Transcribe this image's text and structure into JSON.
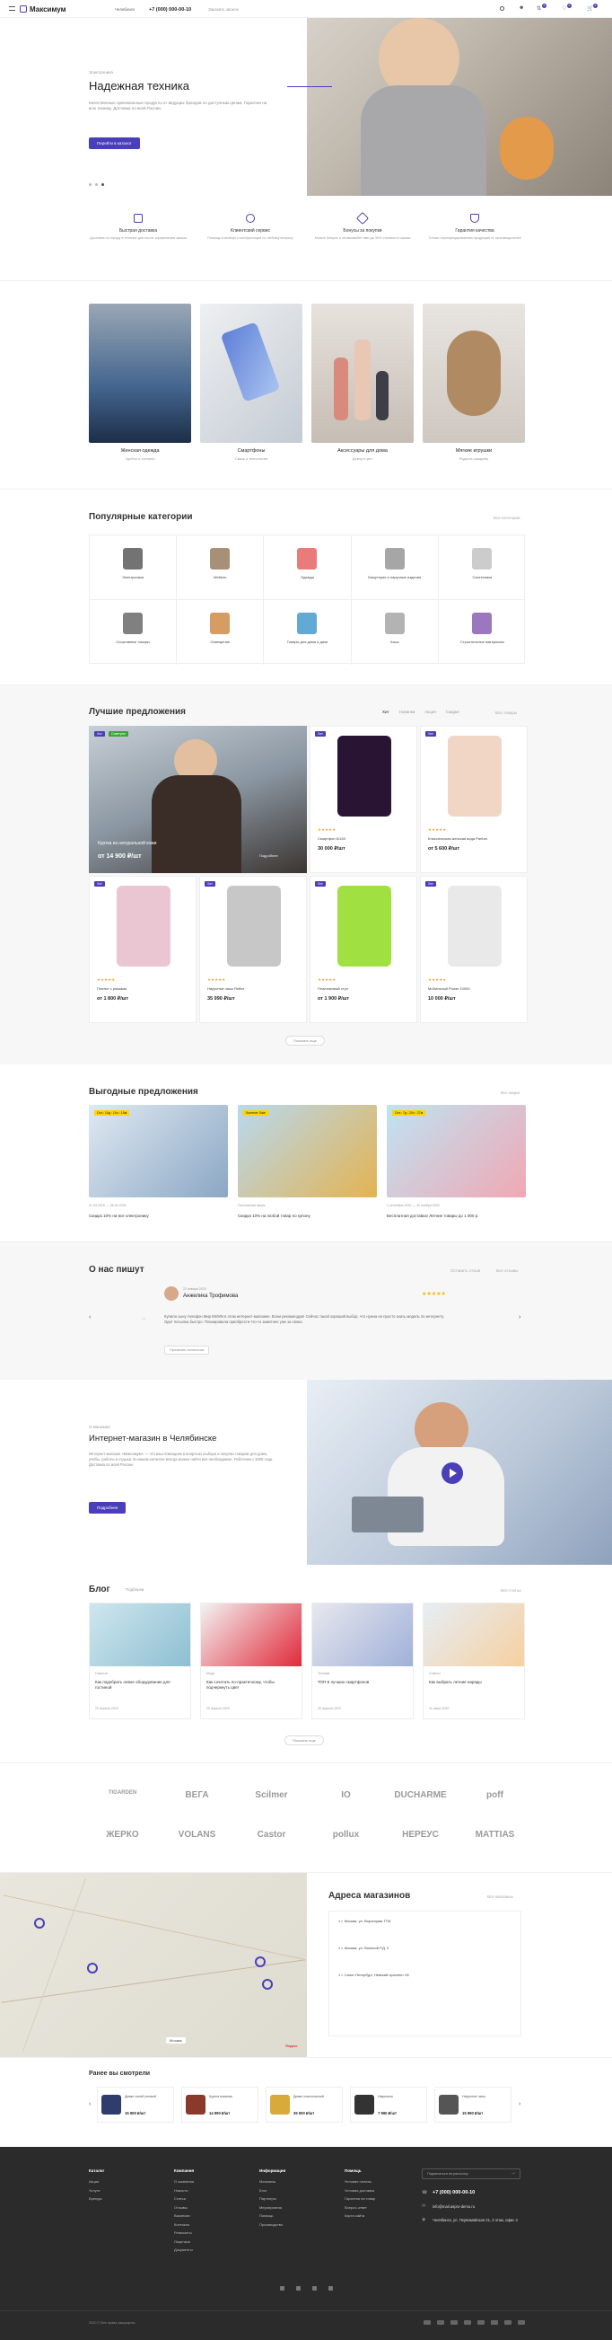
{
  "header": {
    "logo": "Максимум",
    "city": "Челябинск",
    "phone": "+7 (000) 000-00-10",
    "callback": "Заказать звонок",
    "cart_count": "0",
    "compare_count": "0",
    "favorites_count": "0"
  },
  "hero": {
    "tagline": "Электроника",
    "title": "Надежная техника",
    "text": "Качественные оригинальные продукты от ведущих брендов по доступным ценам. Гарантия на всю технику. Доставка по всей России.",
    "button": "Перейти в каталог"
  },
  "features": [
    {
      "icon": "bag-icon",
      "title": "Быстрая доставка",
      "text": "Доставка по городу в течение дня после оформления заказа"
    },
    {
      "icon": "crown-icon",
      "title": "Клиентский сервис",
      "text": "Помощь в выборе и консультации по любому вопросу"
    },
    {
      "icon": "percent-icon",
      "title": "Бонусы за покупки",
      "text": "Копите бонусы и оплачивайте ими до 30% стоимости заказа"
    },
    {
      "icon": "shield-icon",
      "title": "Гарантия качества",
      "text": "Только сертифицированная продукция от производителей"
    }
  ],
  "promo_cards": [
    {
      "title": "Женская одежда",
      "sub": "Удобно и стильно"
    },
    {
      "title": "Смартфоны",
      "sub": "Связь и технологии"
    },
    {
      "title": "Аксессуары для дома",
      "sub": "Декор и уют"
    },
    {
      "title": "Мягкие игрушки",
      "sub": "Радость каждому"
    }
  ],
  "popular": {
    "title": "Популярные категории",
    "all": "Все категории",
    "items": [
      "Электроника",
      "Мебель",
      "Одежда",
      "Бижутерия и наручные изделия",
      "Сантехника",
      "Спортивные товары",
      "Освещение",
      "Товары для дома и дачи",
      "Часы",
      "Строительные материалы"
    ]
  },
  "best": {
    "title": "Лучшие предложения",
    "tabs": [
      "Хит",
      "Новинки",
      "Акция",
      "Скидки"
    ],
    "all": "Все товары",
    "more": "Показать еще",
    "featured": {
      "title": "Куртка из натуральной кожи",
      "price": "от 14 900 ₽/шт",
      "note": "Подробнее"
    },
    "items": [
      {
        "name": "Смартфон 6/128",
        "price": "30 000 ₽/шт",
        "badge": "Хит"
      },
      {
        "name": "Классическая женская вода Parfum",
        "price": "от 5 600 ₽/шт",
        "badge": "Хит"
      },
      {
        "name": "Платье с рюшами",
        "price": "от 1 800 ₽/шт",
        "badge": "Хит"
      },
      {
        "name": "Наручные часы Reflex",
        "price": "35 990 ₽/шт",
        "badge": "Хит"
      },
      {
        "name": "Пластиковый стул",
        "price": "от 1 900 ₽/шт",
        "badge": "Хит"
      },
      {
        "name": "Мобильный Power 10000",
        "price": "10 000 ₽/шт",
        "badge": "Хит"
      }
    ]
  },
  "deals": {
    "title": "Выгодные предложения",
    "all": "Все акции",
    "items": [
      {
        "timer": "Ост.: 10д : 10ч : 15м",
        "date": "01.03.2020 — 26.04.2020",
        "text": "Скидка 10% на все электронику"
      },
      {
        "timer": "Summer Sale",
        "date": "Постоянная акция",
        "text": "Скидка 10% на любой товар по купону"
      },
      {
        "timer": "Ост.: 7д : 20ч : 37м",
        "date": "1 сентября 2020 — 30 ноября 2020",
        "text": "Бесплатная доставка! Летние товары до 1 000 р."
      }
    ]
  },
  "reviews": {
    "title": "О нас пишут",
    "all": "Все отзывы",
    "add": "Оставить отзыв",
    "author": "Анжелика Трофимова",
    "date": "22 января 2020",
    "text": "Купила сыну телефон Мир 8S/MN в этом интернет-магазине. Всем рекомендую! Сейчас такой хороший выбор, что нужна не просто знать модель по интернету. Одет посылка быстро. Планировала приобрести что-то заметнее уже за своих.",
    "more": "Прочитать полностью"
  },
  "about": {
    "tagline": "О магазине",
    "title": "Интернет-магазин в Челябинске",
    "text": "Интернет-магазин «Максимум» — это ваш помощник в вопросах выбора и покупки товаров для дома, учебы, работы и отдыха. В нашем каталоге всегда можно найти всё необходимое. Работаем с 2005 года. Доставка по всей России.",
    "button": "Подробнее"
  },
  "blog": {
    "title": "Блог",
    "filter": "Подборки",
    "all": "Все статьи",
    "more": "Показать еще",
    "items": [
      {
        "tag": "Новости",
        "title": "Как подобрать новое оборудование для гостиной",
        "date": "20 апреля 2020"
      },
      {
        "tag": "Мода",
        "title": "Как сочетать по-практичному, чтобы подчеркнуть цвет",
        "date": "20 апреля 2020"
      },
      {
        "tag": "Техника",
        "title": "ТОП-5 лучших смартфонов",
        "date": "20 апреля 2020"
      },
      {
        "tag": "Советы",
        "title": "Как выбрать летние наряды",
        "date": "11 июня 2020"
      }
    ]
  },
  "brands": [
    "TIGARDEN",
    "ВЕГА",
    "Scilmer",
    "IO",
    "DUCHARME",
    "poff",
    "ЖЕРКО",
    "VOLANS",
    "Castor",
    "pollux",
    "НЕРЕУС",
    "MATTIAS"
  ],
  "stores": {
    "title": "Адреса магазинов",
    "all": "Все магазины",
    "items": [
      "г. Москва, ул. Воронцова ТГМ",
      "г. Москва, ул. Вольной Р.Д. 2",
      "г. Санкт-Петербург, Невский проспект 28"
    ],
    "map_city": "Москва",
    "map_label": "Яндекс"
  },
  "recent": {
    "title": "Ранее вы смотрели",
    "items": [
      {
        "name": "Диван синий угловой",
        "price": "15 900 ₽/шт"
      },
      {
        "name": "Куртка кожаная",
        "price": "14 990 ₽/шт"
      },
      {
        "name": "Диван классический",
        "price": "35 000 ₽/шт"
      },
      {
        "name": "Наушники",
        "price": "7 990 ₽/шт"
      },
      {
        "name": "Наручные часы",
        "price": "15 990 ₽/шт"
      }
    ]
  },
  "footer": {
    "cols": [
      {
        "title": "Каталог",
        "links": [
          "Акции",
          "Услуги",
          "Бренды"
        ]
      },
      {
        "title": "Компания",
        "links": [
          "О компании",
          "Новости",
          "Статьи",
          "Отзывы",
          "Вакансии",
          "Контакты",
          "Реквизиты",
          "Лицензии",
          "Документы"
        ]
      },
      {
        "title": "Информация",
        "links": [
          "Магазины",
          "Блог",
          "Партнеры",
          "Мероприятия",
          "Помощь",
          "Производство"
        ]
      },
      {
        "title": "Помощь",
        "links": [
          "Условия оплаты",
          "Условия доставки",
          "Гарантия на товар",
          "Вопрос-ответ",
          "Карта сайта"
        ]
      }
    ],
    "subscribe": "Подписаться на рассылку",
    "phone": "+7 (000) 000-00-10",
    "email": "info@mail.aspro-demo.ru",
    "address": "Челябинск, ул. Первомайская 21, 3 этаж, офис 4",
    "copyright": "2020 © Все права защищены"
  },
  "colors": {
    "accent": "#4a3fb8",
    "footer": "#2b2b2b"
  }
}
